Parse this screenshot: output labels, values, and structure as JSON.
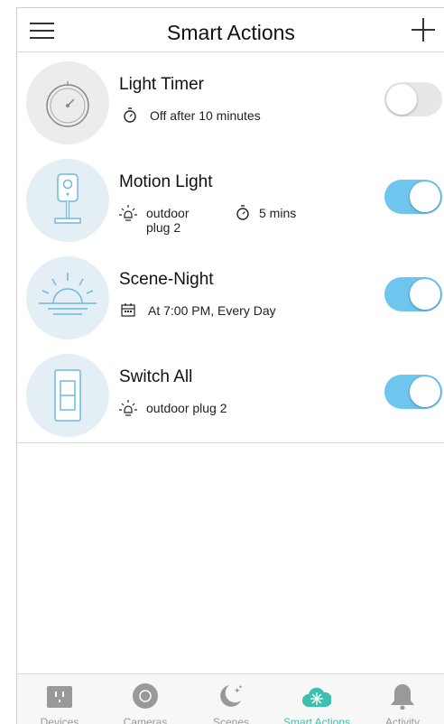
{
  "header": {
    "title": "Smart Actions",
    "menu_icon": "hamburger-menu-icon",
    "add_icon": "plus-icon"
  },
  "actions": [
    {
      "title": "Light Timer",
      "icon": "stopwatch-icon",
      "details": [
        {
          "icon": "timer-icon",
          "text": "Off after 10 minutes"
        }
      ],
      "enabled": false
    },
    {
      "title": "Motion Light",
      "icon": "motion-camera-icon",
      "details": [
        {
          "icon": "bulb-icon",
          "line1": "outdoor",
          "line2": "plug 2"
        },
        {
          "icon": "timer-icon",
          "text": "5 mins"
        }
      ],
      "enabled": true
    },
    {
      "title": "Scene-Night",
      "icon": "sunset-icon",
      "details": [
        {
          "icon": "calendar-icon",
          "text": "At 7:00 PM, Every Day"
        }
      ],
      "enabled": true
    },
    {
      "title": "Switch All",
      "icon": "wall-switch-icon",
      "details": [
        {
          "icon": "bulb-icon",
          "text": "outdoor plug 2"
        }
      ],
      "enabled": true
    }
  ],
  "tabs": [
    {
      "label": "Devices",
      "icon": "plug-outlet-icon",
      "active": false
    },
    {
      "label": "Cameras",
      "icon": "camera-lens-icon",
      "active": false
    },
    {
      "label": "Scenes",
      "icon": "moon-stars-icon",
      "active": false
    },
    {
      "label": "Smart Actions",
      "icon": "cloud-sparkle-icon",
      "active": true
    },
    {
      "label": "Activity",
      "icon": "bell-icon",
      "active": false
    }
  ],
  "colors": {
    "toggle_on": "#6ec6ee",
    "toggle_off": "#e7e7e7",
    "active_tab": "#3fbfae",
    "inactive_tab": "#999999",
    "thumb_bg": "#e3eef5"
  }
}
